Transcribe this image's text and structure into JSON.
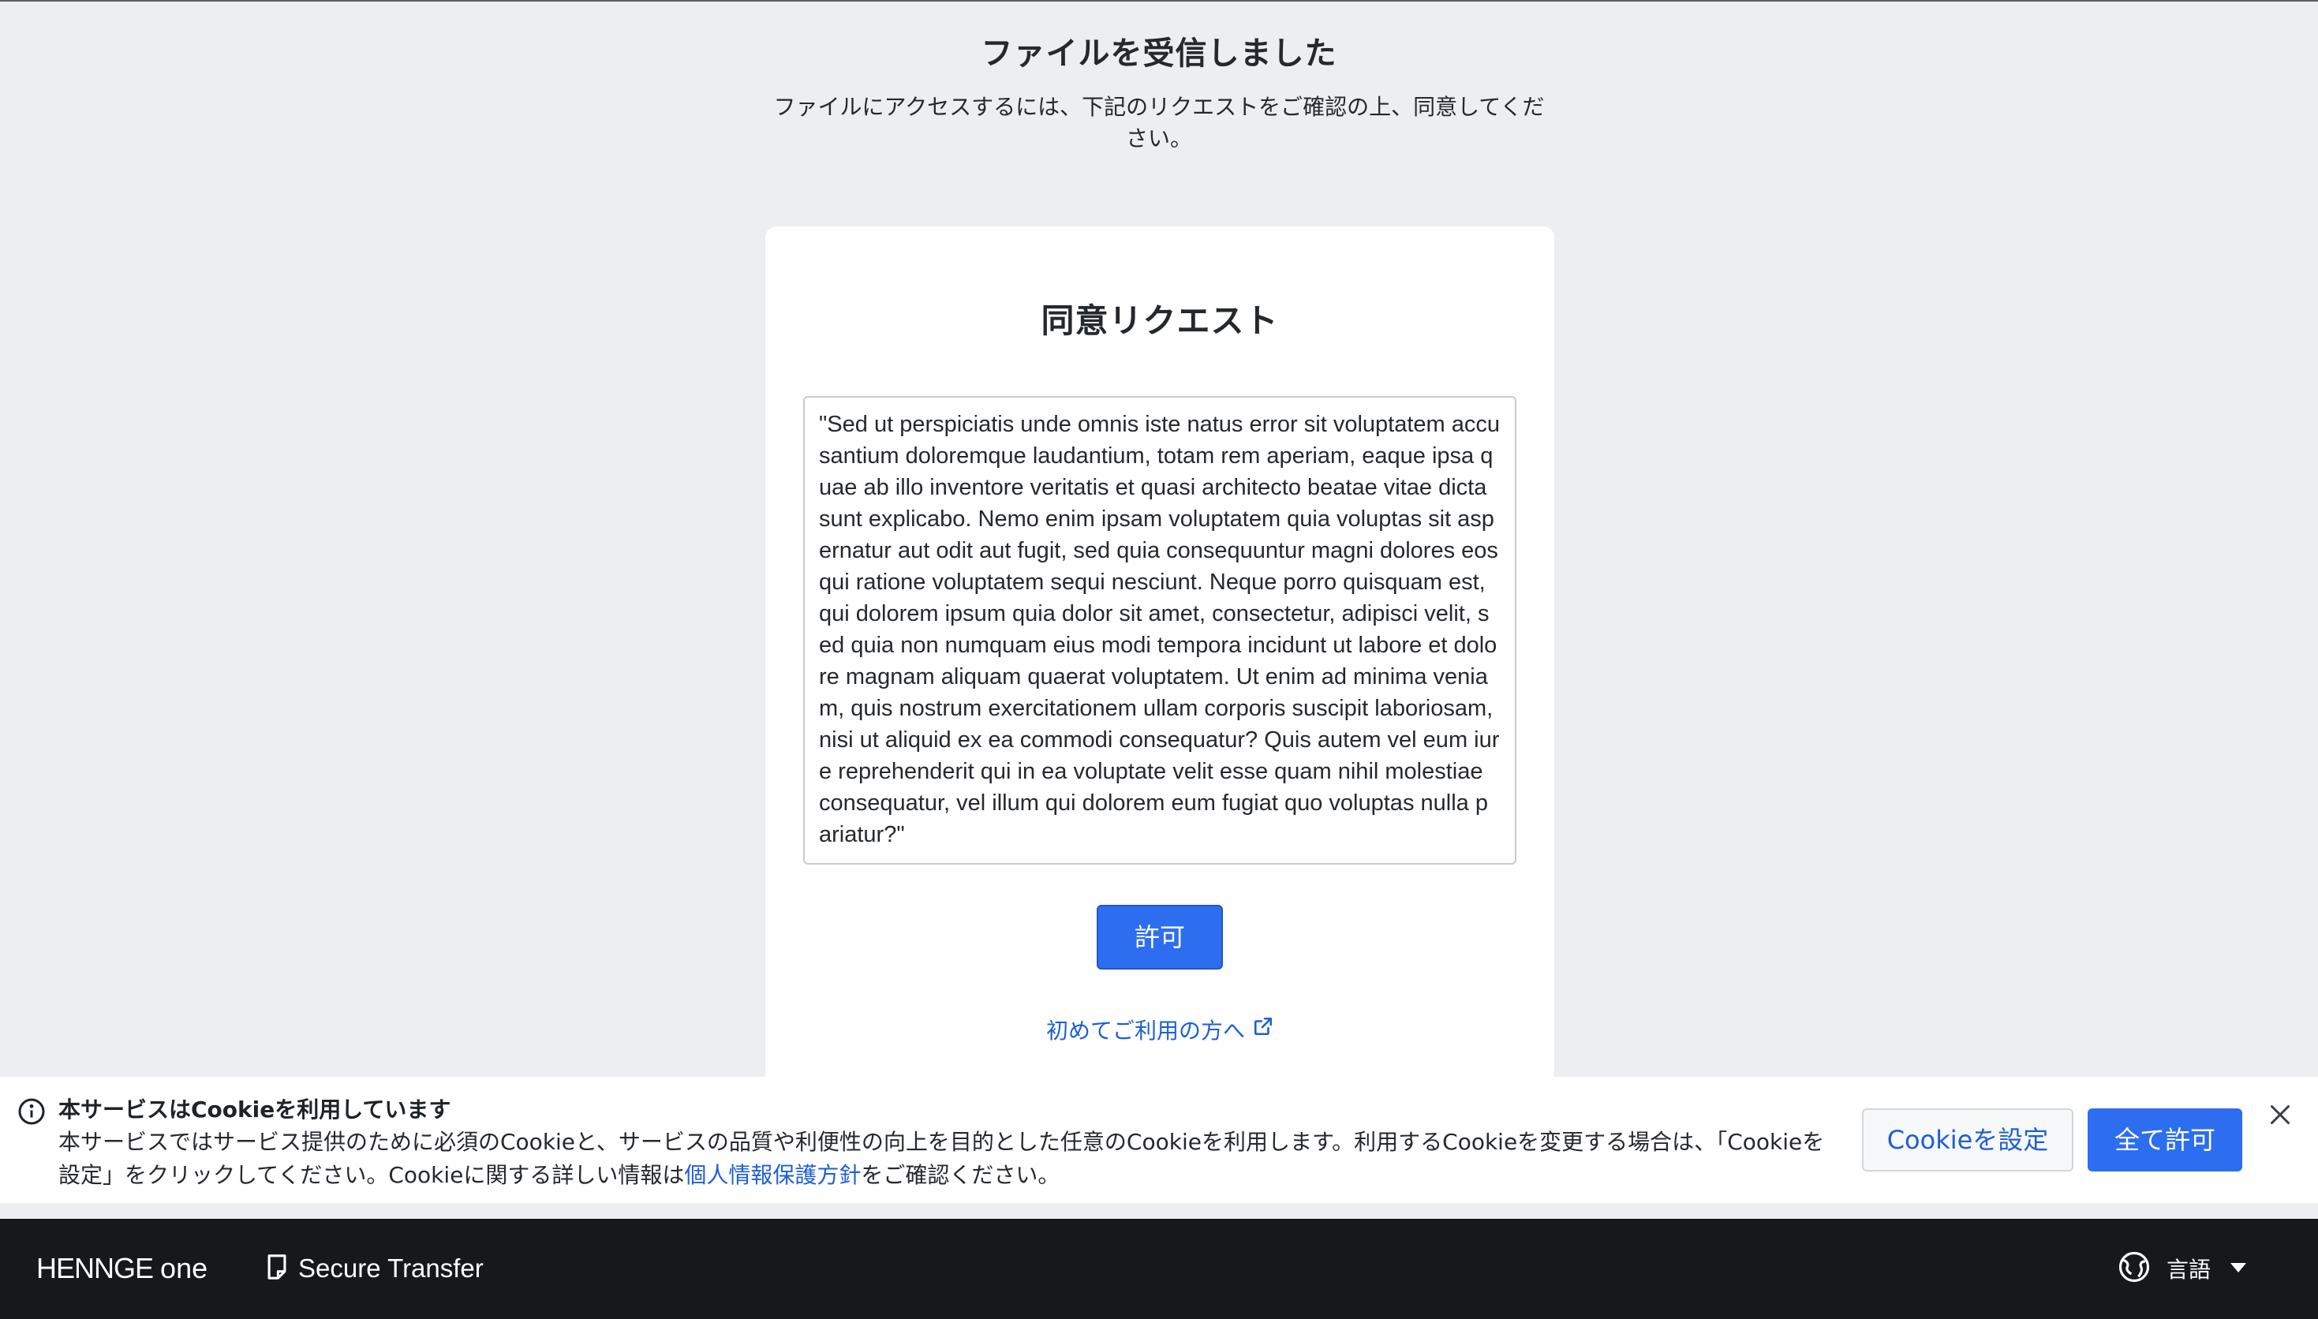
{
  "page": {
    "title": "ファイルを受信しました",
    "subtitle": "ファイルにアクセスするには、下記のリクエストをご確認の上、同意してください。"
  },
  "consent": {
    "heading": "同意リクエスト",
    "text": "\"Sed ut perspiciatis unde omnis iste natus error sit voluptatem accusantium doloremque laudantium, totam rem aperiam, eaque ipsa quae ab illo inventore veritatis et quasi architecto beatae vitae dicta sunt explicabo. Nemo enim ipsam voluptatem quia voluptas sit aspernatur aut odit aut fugit, sed quia consequuntur magni dolores eos qui ratione voluptatem sequi nesciunt. Neque porro quisquam est, qui dolorem ipsum quia dolor sit amet, consectetur, adipisci velit, sed quia non numquam eius modi tempora incidunt ut labore et dolore magnam aliquam quaerat voluptatem. Ut enim ad minima veniam, quis nostrum exercitationem ullam corporis suscipit laboriosam, nisi ut aliquid ex ea commodi consequatur? Quis autem vel eum iure reprehenderit qui in ea voluptate velit esse quam nihil molestiae consequatur, vel illum qui dolorem eum fugiat quo voluptas nulla pariatur?\"",
    "allow_label": "許可",
    "first_time_label": "初めてご利用の方へ"
  },
  "cookie": {
    "title": "本サービスはCookieを利用しています",
    "text_before": "本サービスではサービス提供のために必須のCookieと、サービスの品質や利便性の向上を目的とした任意のCookieを利用します。利用するCookieを変更する場合は、「Cookieを設定」をクリックしてください。Cookieに関する詳しい情報は",
    "link_label": "個人情報保護方針",
    "text_after": "をご確認ください。",
    "settings_label": "Cookieを設定",
    "allow_all_label": "全て許可"
  },
  "footer": {
    "brand_henne": "HENNGE",
    "brand_one": "one",
    "product": "Secure Transfer",
    "language_label": "言語"
  },
  "colors": {
    "primary": "#2d6ef0",
    "link": "#1e5fd4",
    "background": "#edeef2",
    "footer": "#17181b"
  }
}
